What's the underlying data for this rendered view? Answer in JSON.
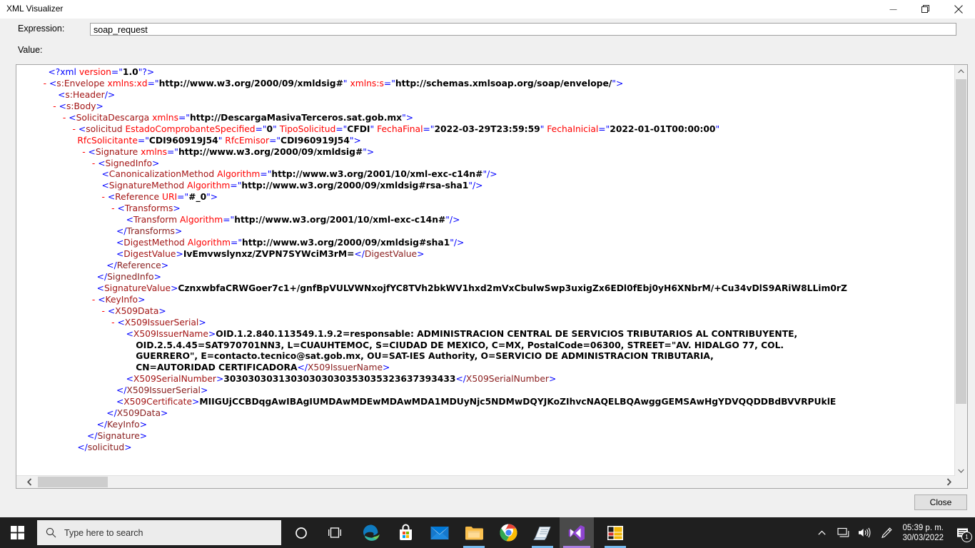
{
  "window": {
    "title": "XML Visualizer",
    "minimize_icon": "minimize-icon",
    "restore_icon": "restore-icon",
    "close_icon": "close-icon"
  },
  "form": {
    "expression_label": "Expression:",
    "expression_value": "soap_request",
    "value_label": "Value:"
  },
  "footer": {
    "close_label": "Close"
  },
  "scrollbars": {
    "v_up_icon": "chevron-up-icon",
    "v_down_icon": "chevron-down-icon",
    "h_left_icon": "chevron-left-icon",
    "h_right_icon": "chevron-right-icon"
  },
  "taskbar": {
    "start_icon": "windows-start-icon",
    "search_icon": "search-icon",
    "search_placeholder": "Type here to search",
    "cortana_icon": "cortana-circle-icon",
    "taskview_icon": "task-view-icon",
    "apps": [
      {
        "name": "microsoft-edge-icon",
        "label": "Microsoft Edge",
        "active": false,
        "open": false
      },
      {
        "name": "microsoft-store-icon",
        "label": "Microsoft Store",
        "active": false,
        "open": false
      },
      {
        "name": "mail-icon",
        "label": "Mail",
        "active": false,
        "open": false
      },
      {
        "name": "file-explorer-icon",
        "label": "File Explorer",
        "active": false,
        "open": true
      },
      {
        "name": "google-chrome-icon",
        "label": "Google Chrome",
        "active": false,
        "open": false
      },
      {
        "name": "sticky-notes-icon",
        "label": "Sticky Notes",
        "active": false,
        "open": true
      },
      {
        "name": "visual-studio-icon",
        "label": "Visual Studio",
        "active": true,
        "open": true
      },
      {
        "name": "sql-server-studio-icon",
        "label": "SQL Server Management Studio",
        "active": false,
        "open": true
      }
    ],
    "tray": {
      "show_hidden_icon": "chevron-up-icon",
      "network_icon": "network-icon",
      "volume_icon": "volume-icon",
      "pen_icon": "pen-workspace-icon",
      "time": "05:39 p. m.",
      "date": "30/03/2022",
      "notification_icon": "notifications-icon",
      "notification_count": "1"
    }
  },
  "colors": {
    "tag": "#a31515",
    "close_tag": "#8b2020",
    "attribute": "#ff0000",
    "bracket": "#0000ff",
    "value": "#000000",
    "accent": "#0078d7",
    "taskbar_bg": "#1f1f1f"
  },
  "xml": {
    "lines": [
      {
        "indent": 3,
        "marker": "",
        "segments": [
          {
            "c": "br",
            "t": "<?xml "
          },
          {
            "c": "attr",
            "t": "version"
          },
          {
            "c": "br",
            "t": "=\""
          },
          {
            "c": "str",
            "t": "1.0"
          },
          {
            "c": "br",
            "t": "\"?>"
          }
        ]
      },
      {
        "indent": 2,
        "marker": "-",
        "segments": [
          {
            "c": "br",
            "t": "<"
          },
          {
            "c": "tag",
            "t": "s:Envelope"
          },
          {
            "c": "br",
            "t": " "
          },
          {
            "c": "attr",
            "t": "xmlns:xd"
          },
          {
            "c": "br",
            "t": "=\""
          },
          {
            "c": "str",
            "t": "http://www.w3.org/2000/09/xmldsig#"
          },
          {
            "c": "br",
            "t": "\" "
          },
          {
            "c": "attr",
            "t": "xmlns:s"
          },
          {
            "c": "br",
            "t": "=\""
          },
          {
            "c": "str",
            "t": "http://schemas.xmlsoap.org/soap/envelope/"
          },
          {
            "c": "br",
            "t": "\">"
          }
        ]
      },
      {
        "indent": 5,
        "marker": "",
        "segments": [
          {
            "c": "br",
            "t": "<"
          },
          {
            "c": "tag",
            "t": "s:Header"
          },
          {
            "c": "br",
            "t": "/>"
          }
        ]
      },
      {
        "indent": 4,
        "marker": "-",
        "segments": [
          {
            "c": "br",
            "t": "<"
          },
          {
            "c": "tag",
            "t": "s:Body"
          },
          {
            "c": "br",
            "t": ">"
          }
        ]
      },
      {
        "indent": 6,
        "marker": "-",
        "segments": [
          {
            "c": "br",
            "t": "<"
          },
          {
            "c": "tag",
            "t": "SolicitaDescarga"
          },
          {
            "c": "br",
            "t": " "
          },
          {
            "c": "attr",
            "t": "xmlns"
          },
          {
            "c": "br",
            "t": "=\""
          },
          {
            "c": "str",
            "t": "http://DescargaMasivaTerceros.sat.gob.mx"
          },
          {
            "c": "br",
            "t": "\">"
          }
        ]
      },
      {
        "indent": 8,
        "marker": "-",
        "segments": [
          {
            "c": "br",
            "t": "<"
          },
          {
            "c": "tag",
            "t": "solicitud"
          },
          {
            "c": "br",
            "t": " "
          },
          {
            "c": "attr",
            "t": "EstadoComprobanteSpecified"
          },
          {
            "c": "br",
            "t": "=\""
          },
          {
            "c": "str",
            "t": "0"
          },
          {
            "c": "br",
            "t": "\" "
          },
          {
            "c": "attr",
            "t": "TipoSolicitud"
          },
          {
            "c": "br",
            "t": "=\""
          },
          {
            "c": "str",
            "t": "CFDI"
          },
          {
            "c": "br",
            "t": "\" "
          },
          {
            "c": "attr",
            "t": "FechaFinal"
          },
          {
            "c": "br",
            "t": "=\""
          },
          {
            "c": "str",
            "t": "2022-03-29T23:59:59"
          },
          {
            "c": "br",
            "t": "\" "
          },
          {
            "c": "attr",
            "t": "FechaInicial"
          },
          {
            "c": "br",
            "t": "=\""
          },
          {
            "c": "str",
            "t": "2022-01-01T00:00:00"
          },
          {
            "c": "br",
            "t": "\""
          }
        ]
      },
      {
        "indent": 9,
        "marker": "",
        "segments": [
          {
            "c": "attr",
            "t": "RfcSolicitante"
          },
          {
            "c": "br",
            "t": "=\""
          },
          {
            "c": "str",
            "t": "CDI960919J54"
          },
          {
            "c": "br",
            "t": "\" "
          },
          {
            "c": "attr",
            "t": "RfcEmisor"
          },
          {
            "c": "br",
            "t": "=\""
          },
          {
            "c": "str",
            "t": "CDI960919J54"
          },
          {
            "c": "br",
            "t": "\">"
          }
        ]
      },
      {
        "indent": 10,
        "marker": "-",
        "segments": [
          {
            "c": "br",
            "t": "<"
          },
          {
            "c": "tag",
            "t": "Signature"
          },
          {
            "c": "br",
            "t": " "
          },
          {
            "c": "attr",
            "t": "xmlns"
          },
          {
            "c": "br",
            "t": "=\""
          },
          {
            "c": "str",
            "t": "http://www.w3.org/2000/09/xmldsig#"
          },
          {
            "c": "br",
            "t": "\">"
          }
        ]
      },
      {
        "indent": 12,
        "marker": "-",
        "segments": [
          {
            "c": "br",
            "t": "<"
          },
          {
            "c": "tag",
            "t": "SignedInfo"
          },
          {
            "c": "br",
            "t": ">"
          }
        ]
      },
      {
        "indent": 14,
        "marker": "",
        "segments": [
          {
            "c": "br",
            "t": "<"
          },
          {
            "c": "tag",
            "t": "CanonicalizationMethod"
          },
          {
            "c": "br",
            "t": " "
          },
          {
            "c": "attr",
            "t": "Algorithm"
          },
          {
            "c": "br",
            "t": "=\""
          },
          {
            "c": "str",
            "t": "http://www.w3.org/2001/10/xml-exc-c14n#"
          },
          {
            "c": "br",
            "t": "\"/>"
          }
        ]
      },
      {
        "indent": 14,
        "marker": "",
        "segments": [
          {
            "c": "br",
            "t": "<"
          },
          {
            "c": "tag",
            "t": "SignatureMethod"
          },
          {
            "c": "br",
            "t": " "
          },
          {
            "c": "attr",
            "t": "Algorithm"
          },
          {
            "c": "br",
            "t": "=\""
          },
          {
            "c": "str",
            "t": "http://www.w3.org/2000/09/xmldsig#rsa-sha1"
          },
          {
            "c": "br",
            "t": "\"/>"
          }
        ]
      },
      {
        "indent": 14,
        "marker": "-",
        "segments": [
          {
            "c": "br",
            "t": "<"
          },
          {
            "c": "tag",
            "t": "Reference"
          },
          {
            "c": "br",
            "t": " "
          },
          {
            "c": "attr",
            "t": "URI"
          },
          {
            "c": "br",
            "t": "=\""
          },
          {
            "c": "str",
            "t": "#_0"
          },
          {
            "c": "br",
            "t": "\">"
          }
        ]
      },
      {
        "indent": 16,
        "marker": "-",
        "segments": [
          {
            "c": "br",
            "t": "<"
          },
          {
            "c": "tag",
            "t": "Transforms"
          },
          {
            "c": "br",
            "t": ">"
          }
        ]
      },
      {
        "indent": 19,
        "marker": "",
        "segments": [
          {
            "c": "br",
            "t": "<"
          },
          {
            "c": "tag",
            "t": "Transform"
          },
          {
            "c": "br",
            "t": " "
          },
          {
            "c": "attr",
            "t": "Algorithm"
          },
          {
            "c": "br",
            "t": "=\""
          },
          {
            "c": "str",
            "t": "http://www.w3.org/2001/10/xml-exc-c14n#"
          },
          {
            "c": "br",
            "t": "\"/>"
          }
        ]
      },
      {
        "indent": 17,
        "marker": "",
        "segments": [
          {
            "c": "br",
            "t": "</"
          },
          {
            "c": "ctag",
            "t": "Transforms"
          },
          {
            "c": "br",
            "t": ">"
          }
        ]
      },
      {
        "indent": 17,
        "marker": "",
        "segments": [
          {
            "c": "br",
            "t": "<"
          },
          {
            "c": "tag",
            "t": "DigestMethod"
          },
          {
            "c": "br",
            "t": " "
          },
          {
            "c": "attr",
            "t": "Algorithm"
          },
          {
            "c": "br",
            "t": "=\""
          },
          {
            "c": "str",
            "t": "http://www.w3.org/2000/09/xmldsig#sha1"
          },
          {
            "c": "br",
            "t": "\"/>"
          }
        ]
      },
      {
        "indent": 17,
        "marker": "",
        "segments": [
          {
            "c": "br",
            "t": "<"
          },
          {
            "c": "tag",
            "t": "DigestValue"
          },
          {
            "c": "br",
            "t": ">"
          },
          {
            "c": "txt",
            "t": "IvEmvwslynxz/ZVPN7SYWciM3rM="
          },
          {
            "c": "br",
            "t": "</"
          },
          {
            "c": "ctag",
            "t": "DigestValue"
          },
          {
            "c": "br",
            "t": ">"
          }
        ]
      },
      {
        "indent": 15,
        "marker": "",
        "segments": [
          {
            "c": "br",
            "t": "</"
          },
          {
            "c": "ctag",
            "t": "Reference"
          },
          {
            "c": "br",
            "t": ">"
          }
        ]
      },
      {
        "indent": 13,
        "marker": "",
        "segments": [
          {
            "c": "br",
            "t": "</"
          },
          {
            "c": "ctag",
            "t": "SignedInfo"
          },
          {
            "c": "br",
            "t": ">"
          }
        ]
      },
      {
        "indent": 13,
        "marker": "",
        "segments": [
          {
            "c": "br",
            "t": "<"
          },
          {
            "c": "tag",
            "t": "SignatureValue"
          },
          {
            "c": "br",
            "t": ">"
          },
          {
            "c": "txt",
            "t": "CznxwbfaCRWGoer7c1+/gnfBpVULVWNxojfYC8TVh2bkWV1hxd2mVxCbulwSwp3uxigZx6EDl0fEbj0yH6XNbrM/+Cu34vDlS9ARiW8LLim0rZ"
          },
          {
            "c": "br",
            "t": ""
          }
        ]
      },
      {
        "indent": 12,
        "marker": "-",
        "segments": [
          {
            "c": "br",
            "t": "<"
          },
          {
            "c": "tag",
            "t": "KeyInfo"
          },
          {
            "c": "br",
            "t": ">"
          }
        ]
      },
      {
        "indent": 14,
        "marker": "-",
        "segments": [
          {
            "c": "br",
            "t": "<"
          },
          {
            "c": "tag",
            "t": "X509Data"
          },
          {
            "c": "br",
            "t": ">"
          }
        ]
      },
      {
        "indent": 16,
        "marker": "-",
        "segments": [
          {
            "c": "br",
            "t": "<"
          },
          {
            "c": "tag",
            "t": "X509IssuerSerial"
          },
          {
            "c": "br",
            "t": ">"
          }
        ]
      },
      {
        "indent": 19,
        "marker": "",
        "segments": [
          {
            "c": "br",
            "t": "<"
          },
          {
            "c": "tag",
            "t": "X509IssuerName"
          },
          {
            "c": "br",
            "t": ">"
          },
          {
            "c": "txt",
            "t": "OID.1.2.840.113549.1.9.2=responsable: ADMINISTRACION CENTRAL DE SERVICIOS TRIBUTARIOS AL CONTRIBUYENTE,"
          }
        ]
      },
      {
        "indent": 21,
        "marker": "",
        "segments": [
          {
            "c": "txt",
            "t": "OID.2.5.4.45=SAT970701NN3, L=CUAUHTEMOC, S=CIUDAD DE MEXICO, C=MX, PostalCode=06300, STREET=\"AV. HIDALGO 77, COL."
          }
        ]
      },
      {
        "indent": 21,
        "marker": "",
        "segments": [
          {
            "c": "txt",
            "t": "GUERRERO\", E=contacto.tecnico@sat.gob.mx, OU=SAT-IES Authority, O=SERVICIO DE ADMINISTRACION TRIBUTARIA,"
          }
        ]
      },
      {
        "indent": 21,
        "marker": "",
        "segments": [
          {
            "c": "txt",
            "t": "CN=AUTORIDAD CERTIFICADORA"
          },
          {
            "c": "br",
            "t": "</"
          },
          {
            "c": "ctag",
            "t": "X509IssuerName"
          },
          {
            "c": "br",
            "t": ">"
          }
        ]
      },
      {
        "indent": 19,
        "marker": "",
        "segments": [
          {
            "c": "br",
            "t": "<"
          },
          {
            "c": "tag",
            "t": "X509SerialNumber"
          },
          {
            "c": "br",
            "t": ">"
          },
          {
            "c": "txt",
            "t": "30303030313030303030353035323637393433"
          },
          {
            "c": "br",
            "t": "</"
          },
          {
            "c": "ctag",
            "t": "X509SerialNumber"
          },
          {
            "c": "br",
            "t": ">"
          }
        ]
      },
      {
        "indent": 17,
        "marker": "",
        "segments": [
          {
            "c": "br",
            "t": "</"
          },
          {
            "c": "ctag",
            "t": "X509IssuerSerial"
          },
          {
            "c": "br",
            "t": ">"
          }
        ]
      },
      {
        "indent": 17,
        "marker": "",
        "segments": [
          {
            "c": "br",
            "t": "<"
          },
          {
            "c": "tag",
            "t": "X509Certificate"
          },
          {
            "c": "br",
            "t": ">"
          },
          {
            "c": "txt",
            "t": "MIIGUjCCBDqgAwIBAgIUMDAwMDEwMDAwMDA1MDUyNjc5NDMwDQYJKoZIhvcNAQELBQAwggGEMSAwHgYDVQQDDBdBVVRPUklE"
          }
        ]
      },
      {
        "indent": 15,
        "marker": "",
        "segments": [
          {
            "c": "br",
            "t": "</"
          },
          {
            "c": "ctag",
            "t": "X509Data"
          },
          {
            "c": "br",
            "t": ">"
          }
        ]
      },
      {
        "indent": 13,
        "marker": "",
        "segments": [
          {
            "c": "br",
            "t": "</"
          },
          {
            "c": "ctag",
            "t": "KeyInfo"
          },
          {
            "c": "br",
            "t": ">"
          }
        ]
      },
      {
        "indent": 11,
        "marker": "",
        "segments": [
          {
            "c": "br",
            "t": "</"
          },
          {
            "c": "ctag",
            "t": "Signature"
          },
          {
            "c": "br",
            "t": ">"
          }
        ]
      },
      {
        "indent": 9,
        "marker": "",
        "segments": [
          {
            "c": "br",
            "t": "</"
          },
          {
            "c": "ctag",
            "t": "solicitud"
          },
          {
            "c": "br",
            "t": ">"
          }
        ]
      }
    ]
  }
}
